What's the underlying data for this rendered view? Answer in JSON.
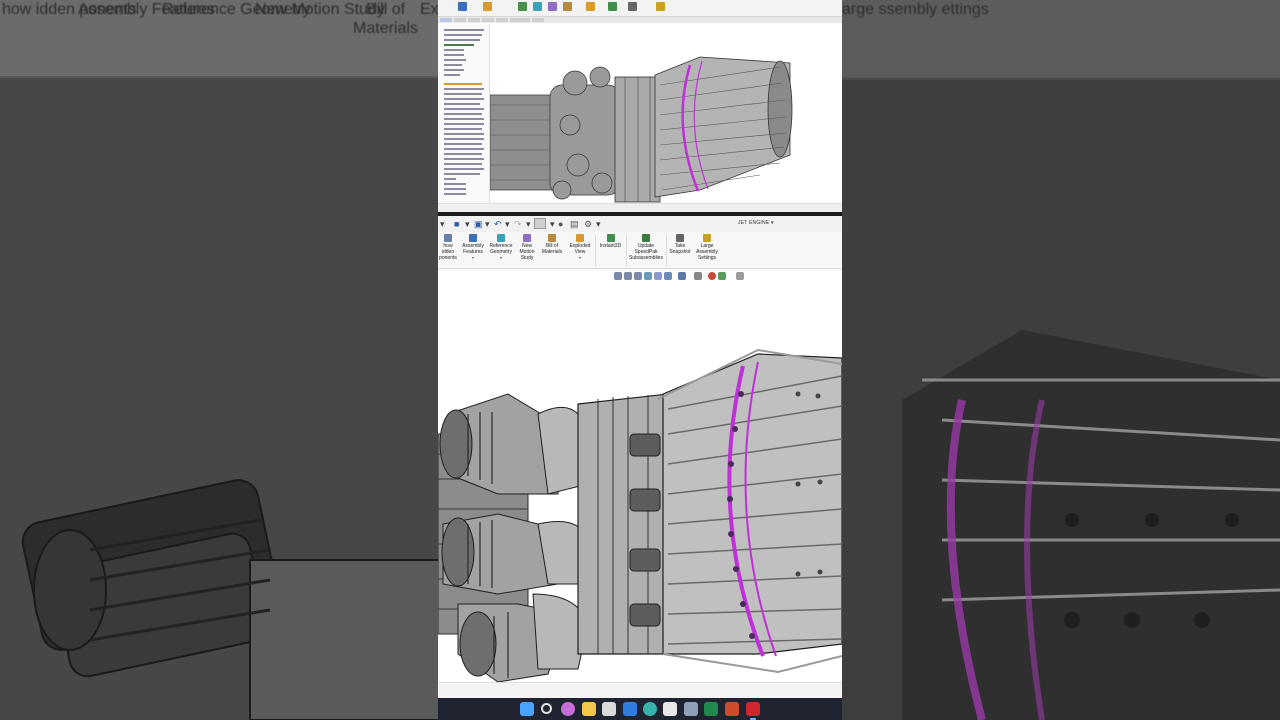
{
  "background_left_ribbon": [
    {
      "id": "show-hidden",
      "label": "how\nidden\nponents"
    },
    {
      "id": "assembly-features",
      "label": "Assembly\nFeatures"
    },
    {
      "id": "reference-geometry",
      "label": "Reference\nGeometry"
    },
    {
      "id": "new-motion-study",
      "label": "New\nMotion\nStudy"
    },
    {
      "id": "bill-of-materials",
      "label": "Bill of\nMaterials"
    },
    {
      "id": "exploded",
      "label": "Ex"
    }
  ],
  "background_right_ribbon": [
    {
      "id": "large-assembly",
      "label": "arge\nssembly\nettings"
    }
  ],
  "document": {
    "title": "JET ENGINE"
  },
  "ribbon": {
    "buttons": [
      {
        "id": "show-hidden-components",
        "label": "how\nidden\nponents",
        "icon": "eye-icon",
        "color": "#6a7fa8"
      },
      {
        "id": "assembly-features",
        "label": "Assembly\nFeatures",
        "icon": "assembly-features-icon",
        "color": "#3b6fb8",
        "dropdown": "▾"
      },
      {
        "id": "reference-geometry",
        "label": "Reference\nGeometry",
        "icon": "reference-geometry-icon",
        "color": "#3aa3b8",
        "dropdown": "▾"
      },
      {
        "id": "new-motion-study",
        "label": "New\nMotion\nStudy",
        "icon": "motion-study-icon",
        "color": "#8e6fc2"
      },
      {
        "id": "bill-of-materials",
        "label": "Bill of\nMaterials",
        "icon": "bill-of-materials-icon",
        "color": "#b58a3a"
      },
      {
        "id": "exploded-view",
        "label": "Exploded\nView",
        "icon": "exploded-view-icon",
        "color": "#d89a2c",
        "dropdown": "▾"
      },
      {
        "id": "instant3d",
        "label": "Instant3D",
        "icon": "instant3d-icon",
        "color": "#3f8f4a"
      },
      {
        "id": "update-speedpak",
        "label": "Update\nSpeedPak\nSubassemblies",
        "icon": "speedpak-icon",
        "color": "#3a7a3a"
      },
      {
        "id": "take-snapshot",
        "label": "Take\nSnapshot",
        "icon": "camera-icon",
        "color": "#666666"
      },
      {
        "id": "large-assembly-settings",
        "label": "Large\nAssembly\nSettings",
        "icon": "large-assembly-icon",
        "color": "#c9a11c"
      }
    ]
  },
  "quick_access": {
    "items": [
      "▾",
      "💾",
      "▾",
      "🖶",
      "▾",
      "↶",
      "▾",
      "↷",
      "▾"
    ]
  },
  "heads_up_toolbar": {
    "icons": [
      "zoom-to-fit-icon",
      "zoom-area-icon",
      "previous-view-icon",
      "section-view-icon",
      "view-selector-icon",
      "view-orientation-icon",
      "display-style-icon",
      "hide-show-icon",
      "edit-appearance-icon",
      "apply-scene-icon",
      "view-settings-icon"
    ]
  },
  "taskbar": {
    "icons": [
      {
        "name": "windows-start-icon",
        "color": "#4aa3ff"
      },
      {
        "name": "search-icon",
        "color": "#e0e0e0"
      },
      {
        "name": "copilot-icon",
        "color": "#c86cd8"
      },
      {
        "name": "file-explorer-icon",
        "color": "#f2c94c"
      },
      {
        "name": "snipping-tool-icon",
        "color": "#d9d9d9"
      },
      {
        "name": "mail-icon",
        "color": "#2f7de1"
      },
      {
        "name": "edge-icon",
        "color": "#35b3a8"
      },
      {
        "name": "store-icon",
        "color": "#e8e8e8"
      },
      {
        "name": "notes-icon",
        "color": "#8fa0b8"
      },
      {
        "name": "excel-icon",
        "color": "#1f8a4c"
      },
      {
        "name": "powerpoint-icon",
        "color": "#d04b2a"
      },
      {
        "name": "solidworks-icon",
        "color": "#d0262f"
      }
    ]
  },
  "colors": {
    "selection_highlight": "#c030d8",
    "ribbon_bg": "#f7f7f7",
    "taskbar_bg": "#1f2430"
  }
}
